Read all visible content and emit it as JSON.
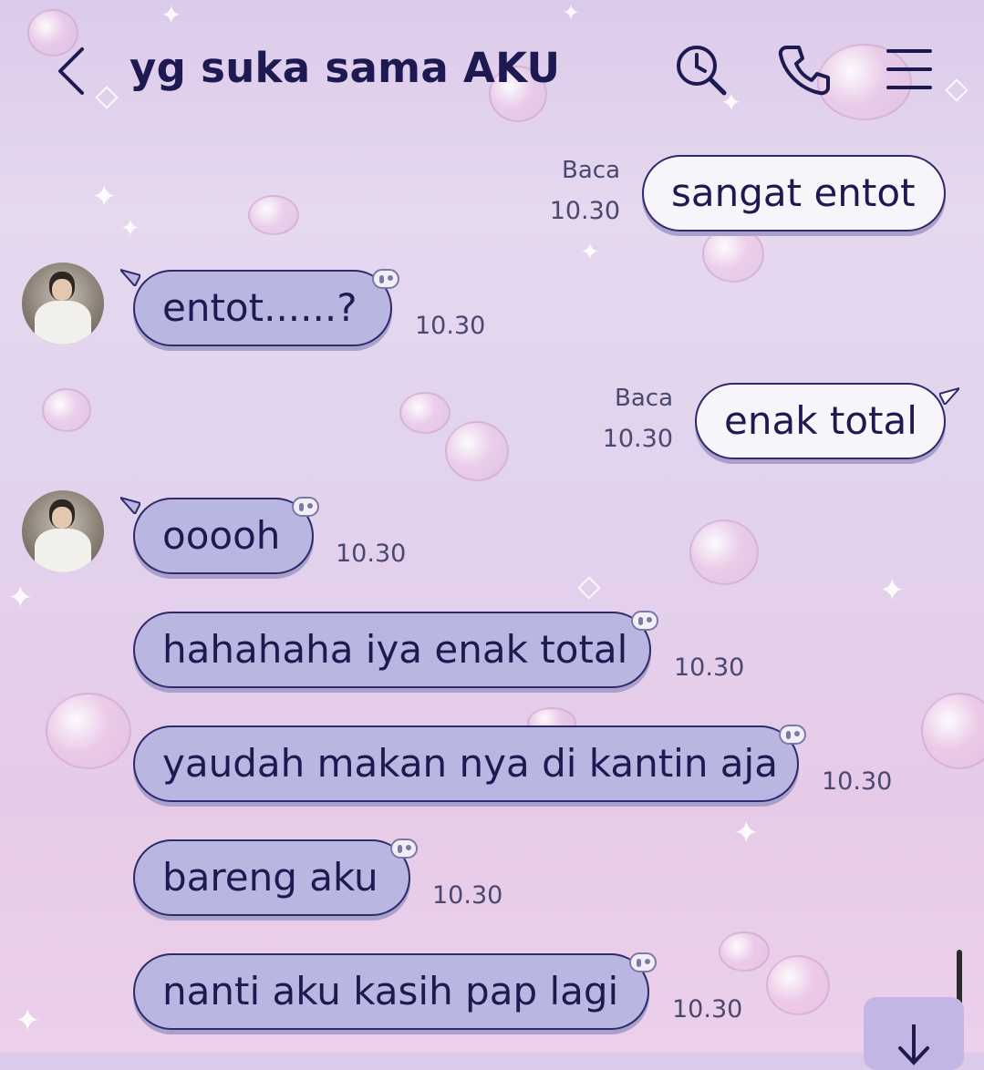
{
  "header": {
    "title": "yg suka sama AKU",
    "icons": [
      "back-icon",
      "search-clock-icon",
      "phone-icon",
      "menu-icon"
    ]
  },
  "messages": [
    {
      "side": "out",
      "text": "sangat entot",
      "read": "Baca",
      "time": "10.30"
    },
    {
      "side": "in",
      "text": "entot......?",
      "time": "10.30"
    },
    {
      "side": "out",
      "text": "enak total",
      "read": "Baca",
      "time": "10.30"
    },
    {
      "side": "in",
      "text": "ooooh",
      "time": "10.30"
    },
    {
      "side": "in",
      "text": "hahahaha iya enak total",
      "time": "10.30"
    },
    {
      "side": "in",
      "text": "yaudah makan nya di kantin aja",
      "time": "10.30"
    },
    {
      "side": "in",
      "text": "bareng aku",
      "time": "10.30"
    },
    {
      "side": "in",
      "text": "nanti aku kasih pap lagi",
      "time": "10.30"
    }
  ],
  "colors": {
    "accent": "#1d1a52",
    "incoming_bubble": "#b9b6e2",
    "outgoing_bubble": "#f7f4fa"
  }
}
